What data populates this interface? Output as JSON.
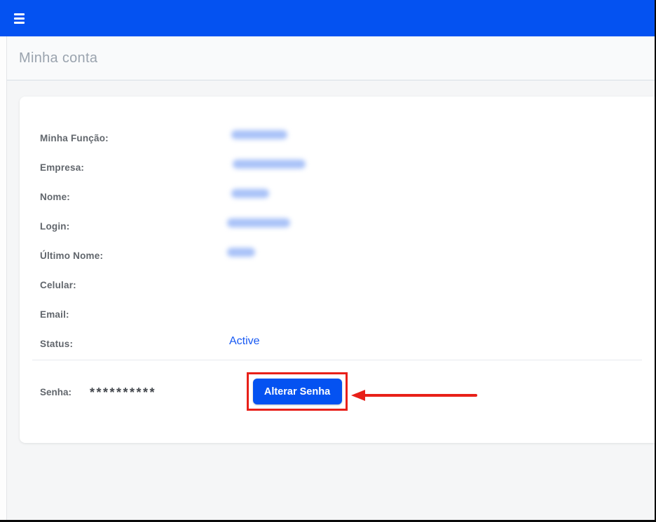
{
  "colors": {
    "topbar_blue": "#0452f1",
    "button_blue": "#0452f1",
    "status_link_blue": "#1658f3",
    "annotation_red": "#e82019",
    "page_title_gray": "#9aa3ae",
    "label_gray": "#61666c"
  },
  "page": {
    "title": "Minha conta"
  },
  "account": {
    "fields": [
      {
        "label": "Minha Função:",
        "value": "",
        "redacted": true
      },
      {
        "label": "Empresa:",
        "value": "",
        "redacted": true
      },
      {
        "label": "Nome:",
        "value": "",
        "redacted": true
      },
      {
        "label": "Login:",
        "value": "",
        "redacted": true
      },
      {
        "label": "Último Nome:",
        "value": "",
        "redacted": true
      },
      {
        "label": "Celular:",
        "value": "",
        "redacted": false
      },
      {
        "label": "Email:",
        "value": "",
        "redacted": false
      },
      {
        "label": "Status:",
        "value": "Active",
        "redacted": false
      }
    ],
    "password": {
      "label": "Senha:",
      "masked_value": "**********",
      "change_button_label": "Alterar Senha"
    }
  }
}
